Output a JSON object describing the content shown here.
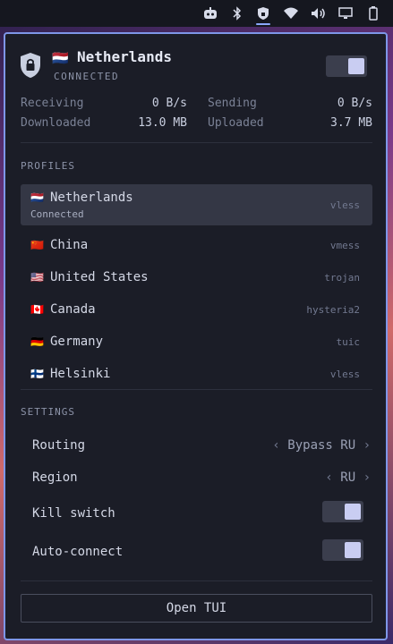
{
  "tray": {
    "icons": [
      "robot-icon",
      "bluetooth-icon",
      "vpn-shield-icon",
      "wifi-icon",
      "volume-icon",
      "display-icon",
      "battery-icon"
    ]
  },
  "header": {
    "country_flag": "🇳🇱",
    "country": "Netherlands",
    "status": "CONNECTED",
    "toggle_on": true
  },
  "stats": {
    "receiving_label": "Receiving",
    "receiving_value": "0 B/s",
    "sending_label": "Sending",
    "sending_value": "0 B/s",
    "downloaded_label": "Downloaded",
    "downloaded_value": "13.0 MB",
    "uploaded_label": "Uploaded",
    "uploaded_value": "3.7 MB"
  },
  "profiles": {
    "heading": "PROFILES",
    "items": [
      {
        "flag": "🇳🇱",
        "name": "Netherlands",
        "status": "Connected",
        "protocol": "vless"
      },
      {
        "flag": "🇨🇳",
        "name": "China",
        "protocol": "vmess"
      },
      {
        "flag": "🇺🇸",
        "name": "United States",
        "protocol": "trojan"
      },
      {
        "flag": "🇨🇦",
        "name": "Canada",
        "protocol": "hysteria2"
      },
      {
        "flag": "🇩🇪",
        "name": "Germany",
        "protocol": "tuic"
      },
      {
        "flag": "🇫🇮",
        "name": "Helsinki",
        "protocol": "vless"
      }
    ]
  },
  "settings": {
    "heading": "SETTINGS",
    "routing_label": "Routing",
    "routing_value": "Bypass RU",
    "region_label": "Region",
    "region_value": "RU",
    "kill_switch_label": "Kill switch",
    "kill_switch_on": true,
    "auto_connect_label": "Auto-connect",
    "auto_connect_on": true
  },
  "footer": {
    "open_tui_label": "Open TUI"
  },
  "colors": {
    "accent": "#7e96e8",
    "panel_bg": "#1b1d27",
    "selected_bg": "#343745"
  }
}
